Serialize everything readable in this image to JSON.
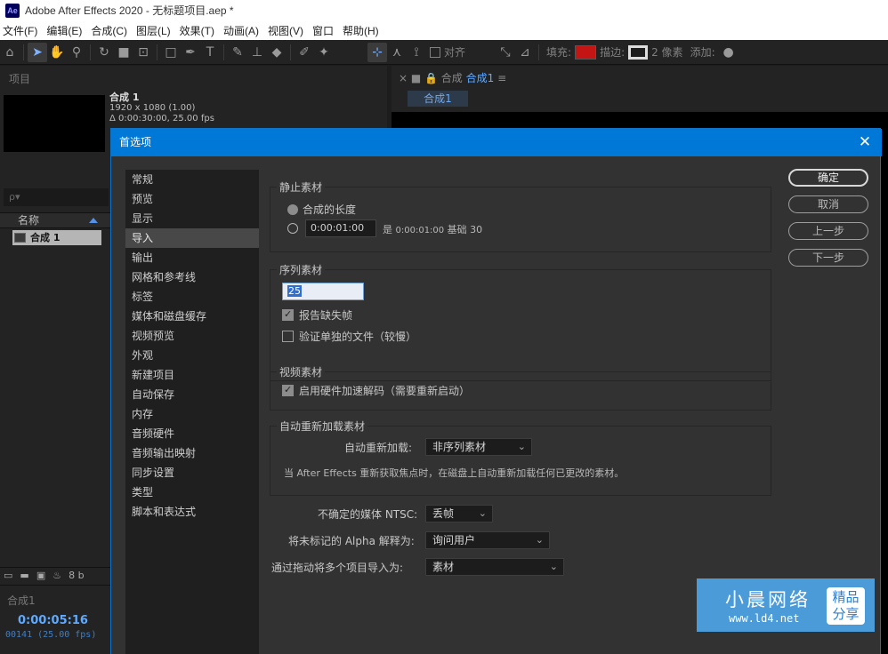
{
  "window": {
    "logo": "Ae",
    "title": "Adobe After Effects 2020 - 无标题项目.aep *"
  },
  "menu": [
    "文件(F)",
    "编辑(E)",
    "合成(C)",
    "图层(L)",
    "效果(T)",
    "动画(A)",
    "视图(V)",
    "窗口",
    "帮助(H)"
  ],
  "toolbar": {
    "align_label": "对齐",
    "fill_label": "填充:",
    "stroke_label": "描边:",
    "stroke_width": "2 像素",
    "add_label": "添加:",
    "fill_color": "#c41515"
  },
  "project_panel": {
    "tab": "项目",
    "comp_name": "合成 1",
    "comp_res": "1920 x 1080 (1.00)",
    "comp_dur": "Δ 0:00:30:00, 25.00 fps",
    "search_placeholder": "ρ▾",
    "col_name": "名称",
    "row_name": "合成 1",
    "bpc": "8 b"
  },
  "timeline": {
    "tab": "合成1",
    "time": "0:00:05:16",
    "frames": "00141 (25.00 fps)"
  },
  "viewer": {
    "tab_prefix": "合成",
    "tab_name": "合成1",
    "sub_tab": "合成1"
  },
  "dialog": {
    "title": "首选项",
    "categories": [
      "常规",
      "预览",
      "显示",
      "导入",
      "输出",
      "网格和参考线",
      "标签",
      "媒体和磁盘缓存",
      "视频预览",
      "外观",
      "新建项目",
      "自动保存",
      "内存",
      "音频硬件",
      "音频输出映射",
      "同步设置",
      "类型",
      "脚本和表达式"
    ],
    "selected_category": "导入",
    "still": {
      "label": "静止素材",
      "opt1": "合成的长度",
      "duration": "0:00:01:00",
      "duration_note_prefix": "是",
      "duration_note_value": "0:00:01:00",
      "duration_note_base": "基础 30"
    },
    "sequence": {
      "label": "序列素材",
      "fps_value": "25",
      "report_missing": "报告缺失帧",
      "verify_files": "验证单独的文件（较慢）"
    },
    "video": {
      "label": "视频素材",
      "hw_decode": "启用硬件加速解码（需要重新启动）"
    },
    "auto_reload": {
      "label": "自动重新加载素材",
      "field_label": "自动重新加载:",
      "value": "非序列素材",
      "note": "当 After Effects 重新获取焦点时，在磁盘上自动重新加载任何已更改的素材。"
    },
    "ntsc": {
      "label": "不确定的媒体 NTSC:",
      "value": "丢帧"
    },
    "alpha": {
      "label": "将未标记的 Alpha 解释为:",
      "value": "询问用户"
    },
    "drag": {
      "label": "通过拖动将多个项目导入为:",
      "value": "素材"
    },
    "buttons": {
      "ok": "确定",
      "cancel": "取消",
      "prev": "上一步",
      "next": "下一步"
    }
  },
  "watermark": {
    "name": "小晨网络",
    "url": "www.ld4.net",
    "badge_line1": "精品",
    "badge_line2": "分享"
  }
}
